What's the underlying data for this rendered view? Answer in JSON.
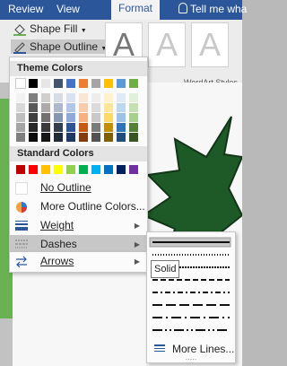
{
  "ribbon": {
    "tabs": [
      {
        "label": "Review"
      },
      {
        "label": "View"
      },
      {
        "label": "Format",
        "active": true
      },
      {
        "label": "Tell me wha"
      }
    ],
    "shape_fill_label": "Shape Fill",
    "shape_outline_label": "Shape Outline",
    "wordart_glyph": "A",
    "wordart_styles_caption": "WordArt Styles"
  },
  "outline_menu": {
    "theme_colors_header": "Theme Colors",
    "standard_colors_header": "Standard Colors",
    "theme_colors": [
      [
        "#ffffff",
        "#000000",
        "#e7e6e6",
        "#44546a",
        "#4472c4",
        "#ed7d31",
        "#a5a5a5",
        "#ffc000",
        "#5b9bd5",
        "#70ad47"
      ],
      [
        "#f2f2f2",
        "#7f7f7f",
        "#d0cece",
        "#d6dce4",
        "#d9e2f3",
        "#fbe5d5",
        "#ededed",
        "#fff2cc",
        "#deebf6",
        "#e2efd9"
      ],
      [
        "#d8d8d8",
        "#595959",
        "#aeaaaa",
        "#adb9ca",
        "#b4c6e7",
        "#f7cbac",
        "#dbdbdb",
        "#fee599",
        "#bdd7ee",
        "#c5e0b3"
      ],
      [
        "#bfbfbf",
        "#3f3f3f",
        "#757070",
        "#8496b0",
        "#8eaadb",
        "#f4b183",
        "#c9c9c9",
        "#ffd965",
        "#9cc3e5",
        "#a8d08d"
      ],
      [
        "#a5a5a5",
        "#262626",
        "#3a3838",
        "#323f4f",
        "#2f5496",
        "#c55a11",
        "#7b7b7b",
        "#bf9000",
        "#2e75b5",
        "#538135"
      ],
      [
        "#7f7f7f",
        "#0c0c0c",
        "#171616",
        "#222a35",
        "#1f3864",
        "#833c0b",
        "#525252",
        "#7f6000",
        "#1e4e79",
        "#375623"
      ]
    ],
    "standard_colors": [
      "#c00000",
      "#ff0000",
      "#ffc000",
      "#ffff00",
      "#92d050",
      "#00b050",
      "#00b0f0",
      "#0070c0",
      "#002060",
      "#7030a0"
    ],
    "items": {
      "no_outline": {
        "label": "No Outline",
        "icon": "blank-swatch-icon"
      },
      "more_colors": {
        "label": "More Outline Colors...",
        "icon": "color-palette-icon"
      },
      "weight": {
        "label": "Weight",
        "icon": "line-weight-icon"
      },
      "dashes": {
        "label": "Dashes",
        "icon": "dashes-icon"
      },
      "arrows": {
        "label": "Arrows",
        "icon": "arrows-icon"
      }
    }
  },
  "dashes_submenu": {
    "styles": [
      "solid",
      "round-dot",
      "square-dot",
      "dash",
      "dash-dot",
      "long-dash",
      "long-dash-dot",
      "long-dash-dot-dot"
    ],
    "selected": "solid",
    "tooltip": "Solid",
    "more_lines_label": "More Lines...",
    "grip": "....."
  },
  "colors": {
    "ribbon_blue": "#2b579a",
    "highlight": "#c7c7c7",
    "shape_fill": "#1e5a28"
  }
}
